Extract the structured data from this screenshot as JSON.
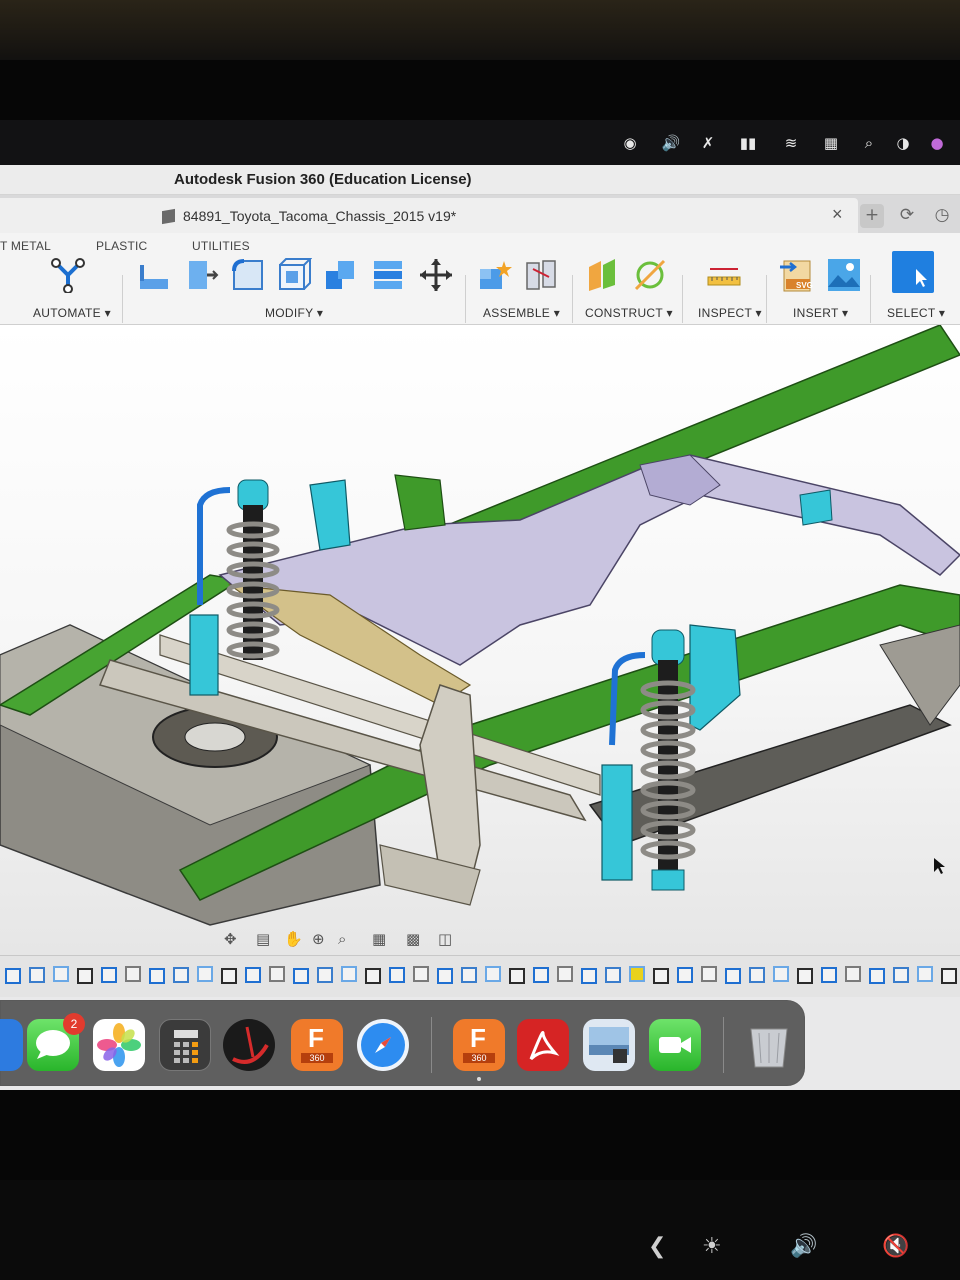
{
  "app": {
    "window_title": "Autodesk Fusion 360 (Education License)",
    "document_tab": "84891_Toyota_Tacoma_Chassis_2015 v19*"
  },
  "ribbon": {
    "tabs": [
      "T METAL",
      "PLASTIC",
      "UTILITIES"
    ],
    "groups": {
      "automate": "AUTOMATE ▾",
      "modify": "MODIFY ▾",
      "assemble": "ASSEMBLE ▾",
      "construct": "CONSTRUCT ▾",
      "inspect": "INSPECT ▾",
      "insert": "INSERT ▾",
      "select": "SELECT ▾"
    }
  },
  "insert_svg_label": "SVG",
  "dock": {
    "messages_badge": "2",
    "fusion_label": "360",
    "fusion_letter": "F"
  },
  "colors": {
    "frame_green": "#3f9a2a",
    "shock_cyan": "#36c6d8",
    "crossmember_lilac": "#c9c4e0",
    "accent_blue": "#1f6fd1"
  }
}
